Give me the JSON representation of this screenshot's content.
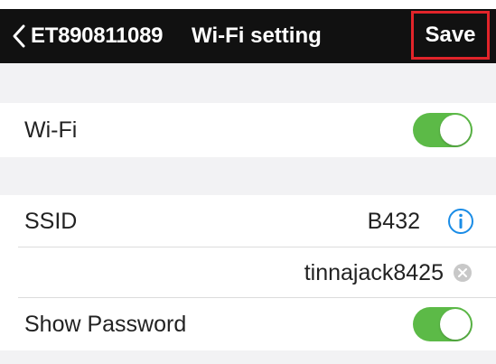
{
  "navbar": {
    "back_label": "ET890811089",
    "title": "Wi-Fi setting",
    "save_label": "Save"
  },
  "wifi": {
    "label": "Wi-Fi",
    "enabled": true
  },
  "ssid": {
    "label": "SSID",
    "value": "B432"
  },
  "password": {
    "value": "tinnajack8425"
  },
  "show_password": {
    "label": "Show Password",
    "enabled": true
  },
  "colors": {
    "navbar_bg": "#111111",
    "toggle_on": "#5cba47",
    "info_blue": "#1a8ce6",
    "highlight_red": "#e2242a",
    "section_gray": "#f2f2f4"
  }
}
